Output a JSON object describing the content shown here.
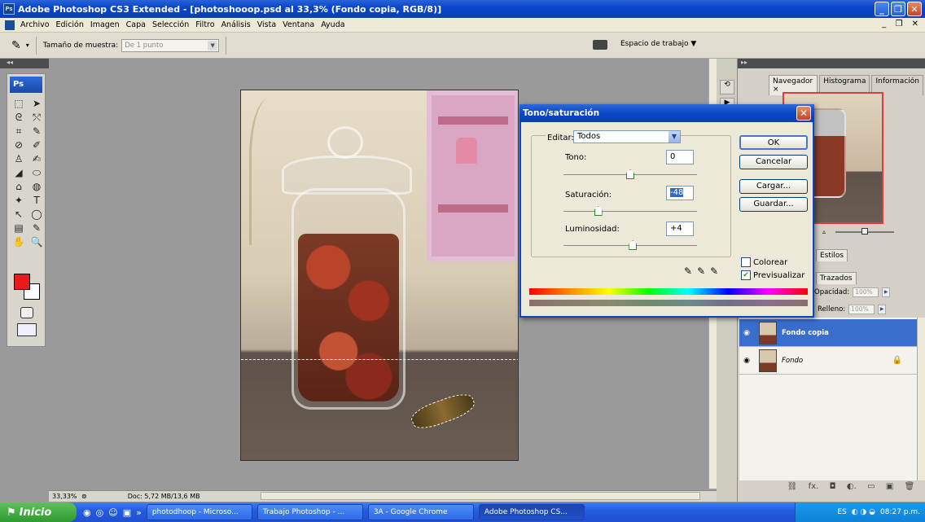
{
  "window": {
    "badge": "Ps",
    "title": "Adobe Photoshop CS3 Extended - [photoshooop.psd al 33,3% (Fondo copia, RGB/8)]",
    "buttons": [
      "_",
      "❐",
      "✕"
    ]
  },
  "menu": {
    "items": [
      "Archivo",
      "Edición",
      "Imagen",
      "Capa",
      "Selección",
      "Filtro",
      "Análisis",
      "Vista",
      "Ventana",
      "Ayuda"
    ]
  },
  "options_bar": {
    "sample_label": "Tamaño de muestra:",
    "sample_value": "De 1 punto",
    "workspace_label": "Espacio de trabajo ▼"
  },
  "toolbox": {
    "logo": "Ps",
    "tools": [
      "⬚",
      "➤",
      "ᘓ",
      "⤲",
      "⌗",
      "✎",
      "⊘",
      "✐",
      "♙",
      "✍",
      "◢",
      "⬭",
      "⌂",
      "◍",
      "✦",
      "T",
      "↖",
      "◯",
      "▤",
      "✎",
      "✋",
      "🔍"
    ],
    "foreground_color": "#e81b1b",
    "background_color": "#ffffff"
  },
  "status": {
    "zoom": "33,33%",
    "doc": "Doc: 5,72 MB/13,6 MB"
  },
  "panels": {
    "collapse_left": "◂◂",
    "collapse_right": "▸▸",
    "nav_tabs": [
      "Navegador ×",
      "Histograma",
      "Información"
    ],
    "styles_tab": "Estilos",
    "paths_tab": "Trazados",
    "opacity_label": "Opacidad:",
    "opacity_value": "100%",
    "fill_label": "Relleno:",
    "fill_value": "100%",
    "layers": [
      {
        "name": "Fondo copia",
        "selected": true,
        "locked": false
      },
      {
        "name": "Fondo",
        "selected": false,
        "locked": true
      }
    ],
    "footer_icons": [
      "⛓",
      "fx.",
      "◘",
      "◐.",
      "▭",
      "▣",
      "🗑"
    ]
  },
  "dialog": {
    "title": "Tono/saturación",
    "editar_label": "Editar:",
    "editar_value": "Todos",
    "hue": {
      "label": "Tono:",
      "value": "0",
      "level": 0.5
    },
    "saturation": {
      "label": "Saturación:",
      "value": "-48",
      "level": 0.26
    },
    "lightness": {
      "label": "Luminosidad:",
      "value": "+4",
      "level": 0.52
    },
    "buttons": {
      "ok": "OK",
      "cancel": "Cancelar",
      "load": "Cargar...",
      "save": "Guardar..."
    },
    "colorize": {
      "label": "Colorear",
      "checked": false
    },
    "preview": {
      "label": "Previsualizar",
      "checked": true
    }
  },
  "taskbar": {
    "start": "Inicio",
    "tasks": [
      {
        "label": "photodhoop - Microso...",
        "active": false
      },
      {
        "label": "Trabajo Photoshop - ...",
        "active": false
      },
      {
        "label": "3A - Google Chrome",
        "active": false
      },
      {
        "label": "Adobe Photoshop CS...",
        "active": true
      }
    ],
    "lang": "ES",
    "clock": "08:27 p.m."
  }
}
